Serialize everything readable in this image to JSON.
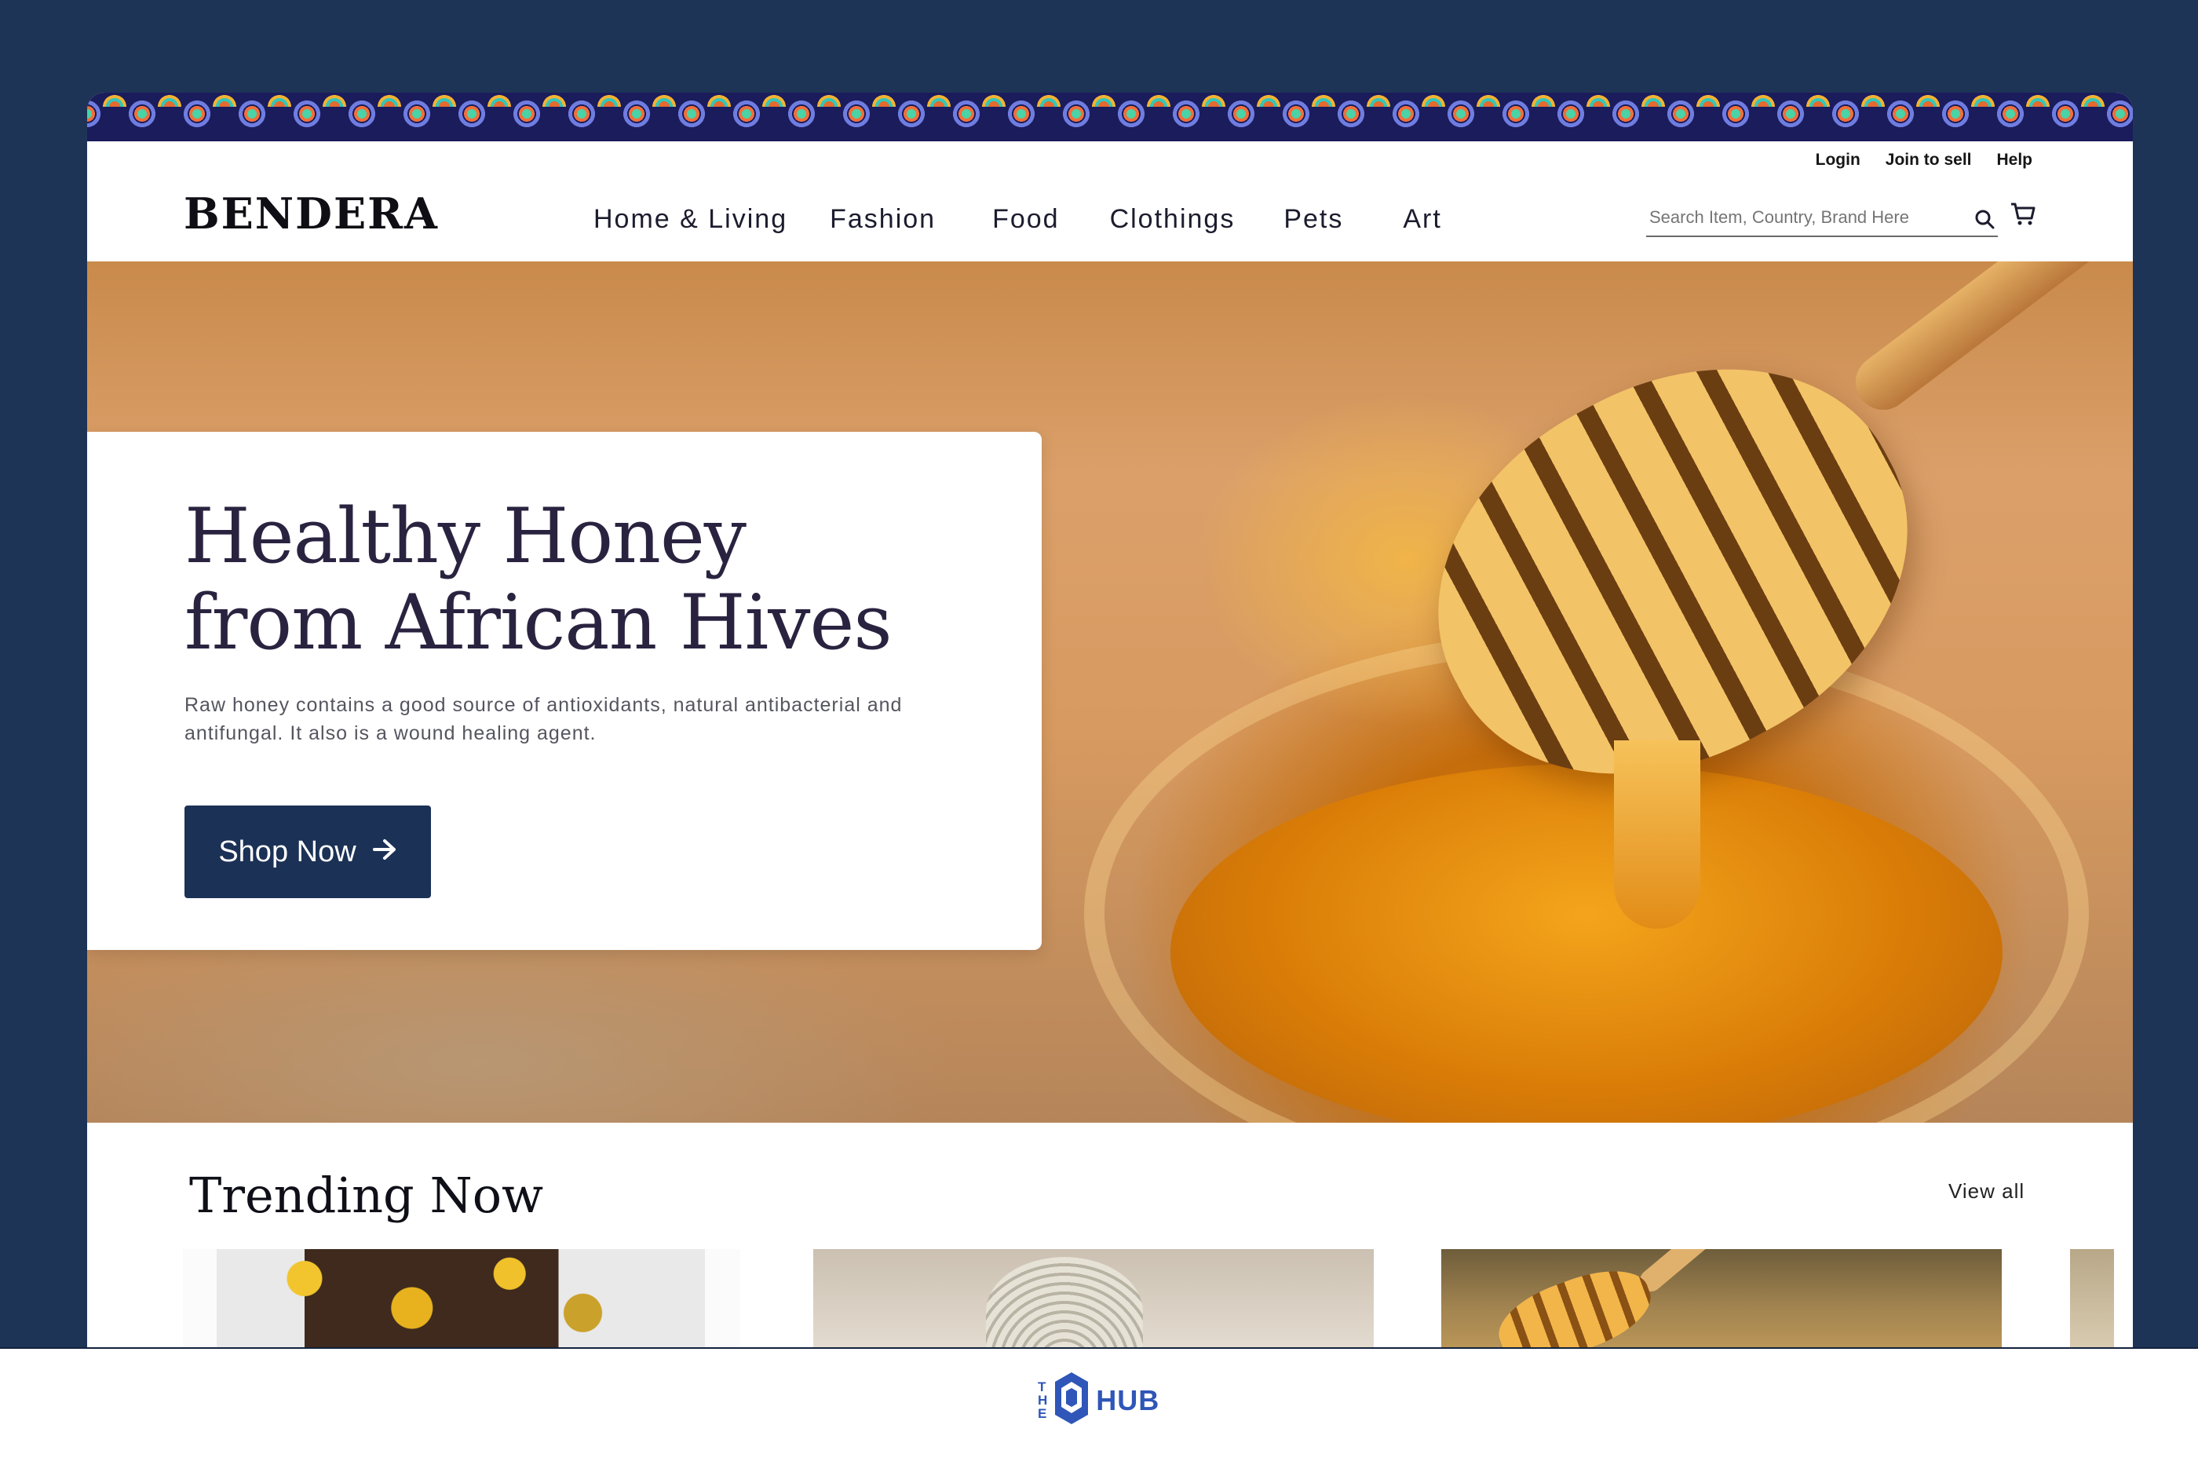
{
  "brand": {
    "logo": "BENDERA"
  },
  "top_links": [
    "Login",
    "Join to sell",
    "Help"
  ],
  "nav": [
    "Home & Living",
    "Fashion",
    "Food",
    "Clothings",
    "Pets",
    "Art"
  ],
  "search": {
    "placeholder": "Search Item, Country, Brand Here"
  },
  "hero": {
    "title_line1": "Healthy Honey",
    "title_line2": "from African Hives",
    "description": "Raw honey contains  a good source of antioxidants, natural antibacterial and antifungal. It also is a wound healing agent.",
    "cta_label": "Shop Now"
  },
  "trending": {
    "title": "Trending Now",
    "view_all": "View all"
  },
  "footer": {
    "logo_the": [
      "T",
      "H",
      "E"
    ],
    "logo_hub": "HUB"
  },
  "colors": {
    "navy": "#1e3457",
    "button": "#1b3156",
    "title": "#2a2340"
  },
  "icons": [
    "search-icon",
    "cart-icon",
    "arrow-right-icon",
    "chevron-left-icon",
    "chevron-right-icon"
  ]
}
